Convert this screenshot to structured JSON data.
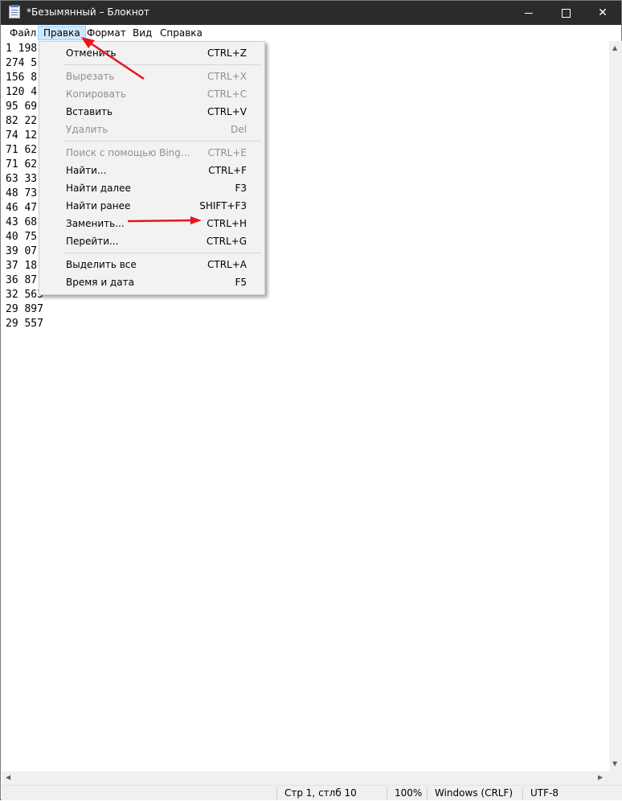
{
  "window": {
    "title": "*Безымянный – Блокнот",
    "app_icon": "notepad-icon",
    "controls": {
      "minimize": "minimize-icon",
      "maximize": "maximize-icon",
      "close": "close-icon",
      "close_glyph": "✕"
    }
  },
  "menubar": {
    "items": [
      {
        "label": "Файл"
      },
      {
        "label": "Правка"
      },
      {
        "label": "Формат"
      },
      {
        "label": "Вид"
      },
      {
        "label": "Справка"
      }
    ]
  },
  "editor": {
    "lines": [
      "1 198",
      "274 5",
      "156 8",
      "120 4",
      "95 69",
      "82 22",
      "74 12",
      "71 62",
      "71 62",
      "63 33",
      "48 73",
      "46 47",
      "43 68",
      "40 75",
      "39 07",
      "37 18",
      "36 87",
      "32 563",
      "29 897",
      "29 557"
    ]
  },
  "edit_menu": {
    "items": [
      {
        "label": "Отменить",
        "shortcut": "CTRL+Z",
        "enabled": true
      },
      {
        "label": "Вырезать",
        "shortcut": "CTRL+X",
        "enabled": false
      },
      {
        "label": "Копировать",
        "shortcut": "CTRL+C",
        "enabled": false
      },
      {
        "label": "Вставить",
        "shortcut": "CTRL+V",
        "enabled": true
      },
      {
        "label": "Удалить",
        "shortcut": "Del",
        "enabled": false
      },
      {
        "label": "Поиск с помощью Bing...",
        "shortcut": "CTRL+E",
        "enabled": false
      },
      {
        "label": "Найти...",
        "shortcut": "CTRL+F",
        "enabled": true
      },
      {
        "label": "Найти далее",
        "shortcut": "F3",
        "enabled": true
      },
      {
        "label": "Найти ранее",
        "shortcut": "SHIFT+F3",
        "enabled": true
      },
      {
        "label": "Заменить...",
        "shortcut": "CTRL+H",
        "enabled": true
      },
      {
        "label": "Перейти...",
        "shortcut": "CTRL+G",
        "enabled": true
      },
      {
        "label": "Выделить все",
        "shortcut": "CTRL+A",
        "enabled": true
      },
      {
        "label": "Время и дата",
        "shortcut": "F5",
        "enabled": true
      }
    ]
  },
  "statusbar": {
    "position": "Стр 1, стлб 10",
    "zoom": "100%",
    "line_ending": "Windows (CRLF)",
    "encoding": "UTF-8"
  },
  "colors": {
    "titlebar": "#2b2b2b",
    "menu_highlight": "#cce8ff",
    "annotation": "#e8141b",
    "disabled_text": "#909090"
  }
}
